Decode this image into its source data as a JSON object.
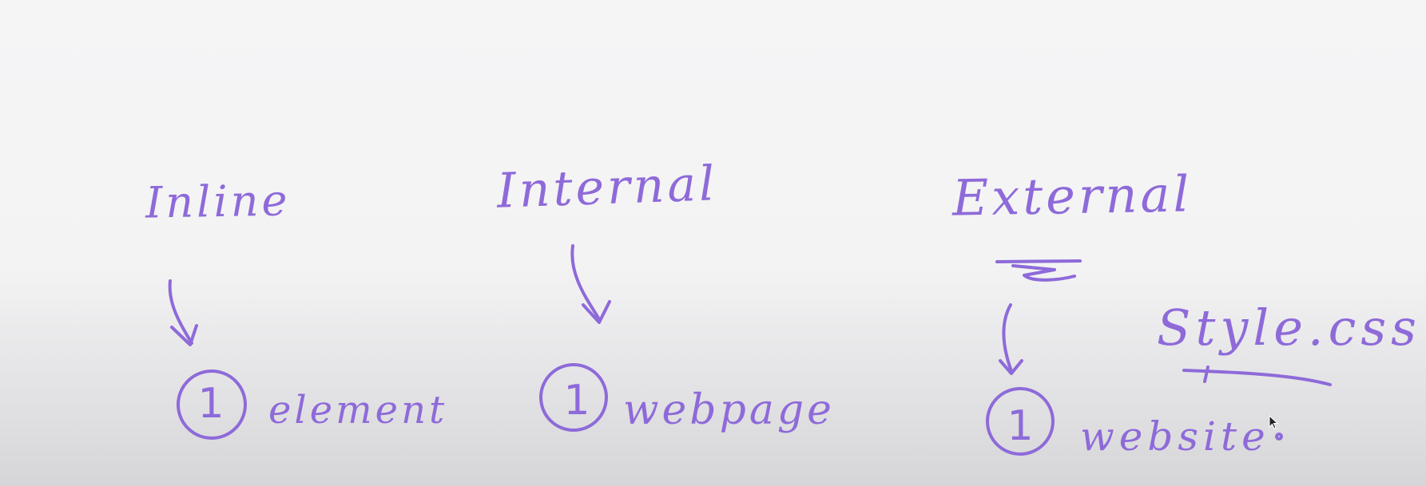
{
  "labels": {
    "inline": "Inline",
    "internal": "Internal",
    "external": "External",
    "style_file": "Style.css"
  },
  "scope": {
    "inline_number": "1",
    "inline_target": "element",
    "internal_number": "1",
    "internal_target": "webpage",
    "external_number": "1",
    "external_target": "website"
  },
  "colors": {
    "ink": "#8e6ad9",
    "background": "#f4f4f5"
  }
}
